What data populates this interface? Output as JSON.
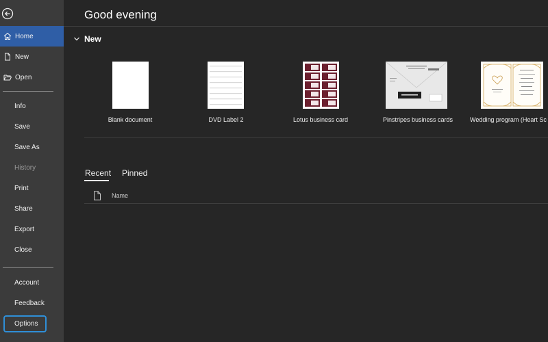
{
  "sidebar": {
    "items": [
      {
        "id": "home",
        "label": "Home"
      },
      {
        "id": "new",
        "label": "New"
      },
      {
        "id": "open",
        "label": "Open"
      },
      {
        "id": "info",
        "label": "Info"
      },
      {
        "id": "save",
        "label": "Save"
      },
      {
        "id": "save-as",
        "label": "Save As"
      },
      {
        "id": "history",
        "label": "History"
      },
      {
        "id": "print",
        "label": "Print"
      },
      {
        "id": "share",
        "label": "Share"
      },
      {
        "id": "export",
        "label": "Export"
      },
      {
        "id": "close",
        "label": "Close"
      },
      {
        "id": "account",
        "label": "Account"
      },
      {
        "id": "feedback",
        "label": "Feedback"
      },
      {
        "id": "options",
        "label": "Options"
      }
    ]
  },
  "main": {
    "greeting": "Good evening",
    "new_section": {
      "title": "New",
      "templates": [
        {
          "label": "Blank document"
        },
        {
          "label": "DVD Label 2"
        },
        {
          "label": "Lotus business card"
        },
        {
          "label": "Pinstripes business cards"
        },
        {
          "label": "Wedding program (Heart Sc"
        }
      ]
    },
    "tabs": [
      {
        "label": "Recent"
      },
      {
        "label": "Pinned"
      }
    ],
    "file_list": {
      "column_name": "Name"
    }
  },
  "colors": {
    "sidebar_bg": "#3b3b3b",
    "main_bg": "#262626",
    "active_item": "#2f5ea6",
    "focus_ring": "#2f8fd8"
  }
}
